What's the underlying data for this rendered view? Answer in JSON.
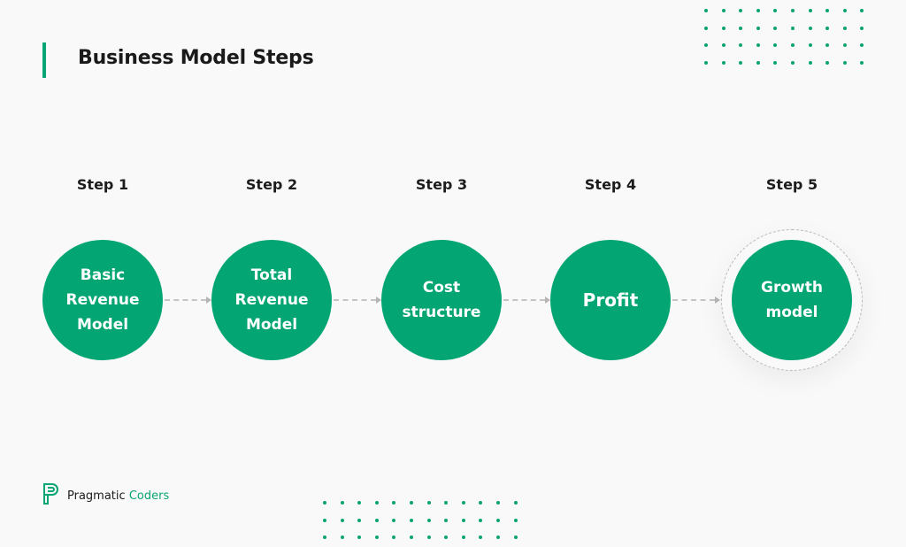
{
  "header": {
    "title": "Business Model Steps"
  },
  "colors": {
    "accent": "#03a572",
    "connector": "#c4c4c4",
    "dots": "#08a371"
  },
  "steps": [
    {
      "label": "Step 1",
      "text": "Basic\nRevenue\nModel"
    },
    {
      "label": "Step 2",
      "text": "Total\nRevenue\nModel"
    },
    {
      "label": "Step 3",
      "text": "Cost\nstructure"
    },
    {
      "label": "Step 4",
      "text": "Profit"
    },
    {
      "label": "Step 5",
      "text": "Growth\nmodel"
    }
  ],
  "decorations": {
    "top_right_dots": {
      "rows": 4,
      "cols": 10
    },
    "bottom_dots": {
      "rows": 3,
      "cols": 12
    }
  },
  "footer": {
    "brand_first": "Pragmatic",
    "brand_second": "Coders",
    "logo_icon": "pragmatic-coders-p-logo"
  }
}
